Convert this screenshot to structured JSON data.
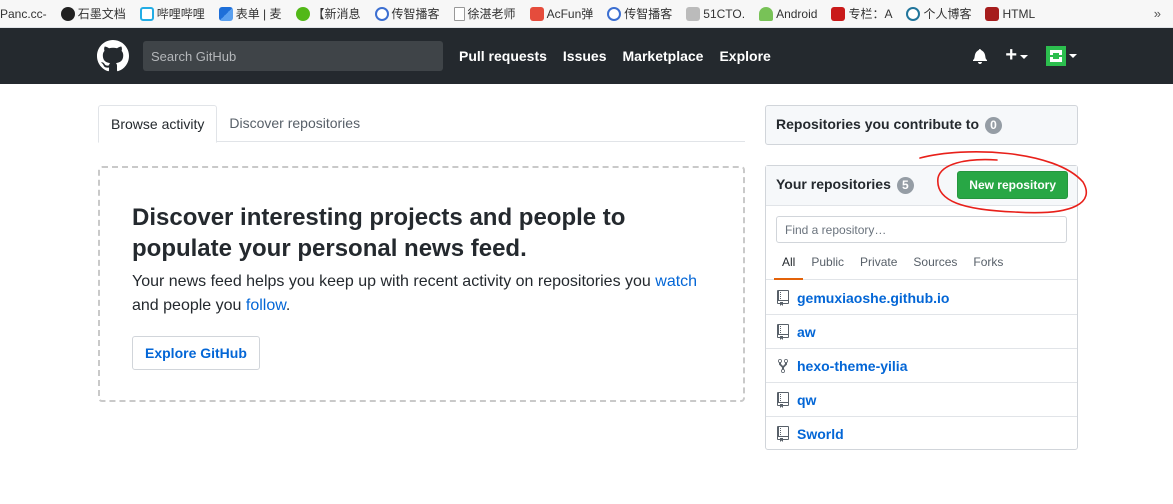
{
  "bookmarks": {
    "items": [
      {
        "label": "Panc.cc-",
        "icon": "none",
        "color": ""
      },
      {
        "label": "石墨文档",
        "icon": "shimo-icon",
        "color": "#222222"
      },
      {
        "label": "哔哩哔哩",
        "icon": "bilibili-icon",
        "color": "#23ade5"
      },
      {
        "label": "表单 | 麦",
        "icon": "form-icon",
        "color": "#1e6fd9"
      },
      {
        "label": "【新消息",
        "icon": "s-icon",
        "color": "#52b818"
      },
      {
        "label": "传智播客",
        "icon": "itcast-icon",
        "color": "#3c6fd1"
      },
      {
        "label": "徐湛老师",
        "icon": "page-icon",
        "color": "#dddddd"
      },
      {
        "label": "AcFun弹",
        "icon": "acfun-icon",
        "color": "#e54c3c"
      },
      {
        "label": "传智播客",
        "icon": "itcast-icon",
        "color": "#3c6fd1"
      },
      {
        "label": "51CTO.",
        "icon": "51cto-icon",
        "color": "#999999"
      },
      {
        "label": "Android",
        "icon": "android-icon",
        "color": "#78c257"
      },
      {
        "label": "专栏：A",
        "icon": "csdn-icon",
        "color": "#c91a1a"
      },
      {
        "label": "个人博客",
        "icon": "wordpress-icon",
        "color": "#21759b"
      },
      {
        "label": "HTML",
        "icon": "w3c-icon",
        "color": "#a61d1d"
      }
    ],
    "more": "»"
  },
  "header": {
    "search_placeholder": "Search GitHub",
    "nav": [
      "Pull requests",
      "Issues",
      "Marketplace",
      "Explore"
    ],
    "plus": "+"
  },
  "tabs": {
    "browse": "Browse activity",
    "discover": "Discover repositories"
  },
  "blankslate": {
    "title": "Discover interesting projects and people to populate your personal news feed.",
    "text_before_watch": "Your news feed helps you keep up with recent activity on repositories you ",
    "watch_link": "watch",
    "text_middle": " and people you ",
    "follow_link": "follow",
    "text_end": ".",
    "explore_button": "Explore GitHub"
  },
  "contribute": {
    "label": "Repositories you contribute to",
    "count": "0"
  },
  "your_repos": {
    "label": "Your repositories",
    "count": "5",
    "new_button": "New repository",
    "filter_placeholder": "Find a repository…",
    "filters": [
      "All",
      "Public",
      "Private",
      "Sources",
      "Forks"
    ],
    "active_filter": "All",
    "repos": [
      {
        "name": "gemuxiaoshe.github.io",
        "icon": "repo-icon"
      },
      {
        "name": "aw",
        "icon": "repo-icon"
      },
      {
        "name": "hexo-theme-yilia",
        "icon": "repo-forked-icon"
      },
      {
        "name": "qw",
        "icon": "repo-icon"
      },
      {
        "name": "Sworld",
        "icon": "repo-icon"
      }
    ]
  },
  "colors": {
    "header_bg": "#24292e",
    "link": "#0366d6",
    "new_button": "#28a745",
    "annotation": "#e8201a"
  }
}
